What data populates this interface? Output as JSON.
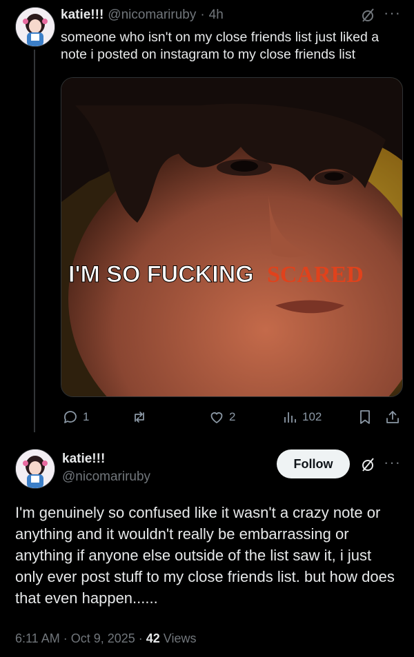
{
  "quoted_post": {
    "display_name": "katie!!!",
    "handle": "@nicomariruby",
    "separator": "·",
    "time": "4h",
    "text": "someone who isn't on my close friends list just liked a note i posted on instagram to my close friends list",
    "media": {
      "caption_white": "I'M SO FUCKING",
      "caption_red": "SCARED"
    },
    "actions": {
      "replies": "1",
      "reposts": "",
      "likes": "2",
      "views": "102"
    }
  },
  "main_post": {
    "display_name": "katie!!!",
    "handle": "@nicomariruby",
    "follow_label": "Follow",
    "text": "I'm genuinely so confused like it wasn't a crazy note or anything and it wouldn't really be embarrassing or anything if anyone else outside of the list saw it, i just only ever post stuff to my close friends list. but how does that even happen......",
    "timestamp": "6:11 AM · Oct 9, 2025 · ",
    "views_count": "42",
    "views_label": " Views"
  },
  "icons": {
    "more": "more-dots-icon",
    "grok": "grok-slash-icon",
    "reply": "reply-bubble-icon",
    "repost": "repost-icon",
    "like": "heart-icon",
    "views": "bar-chart-icon",
    "bookmark": "bookmark-icon",
    "share": "share-icon"
  },
  "colors": {
    "background": "#000000",
    "text": "#e7e9ea",
    "secondary": "#71767b",
    "caption_red": "#e0421c"
  }
}
